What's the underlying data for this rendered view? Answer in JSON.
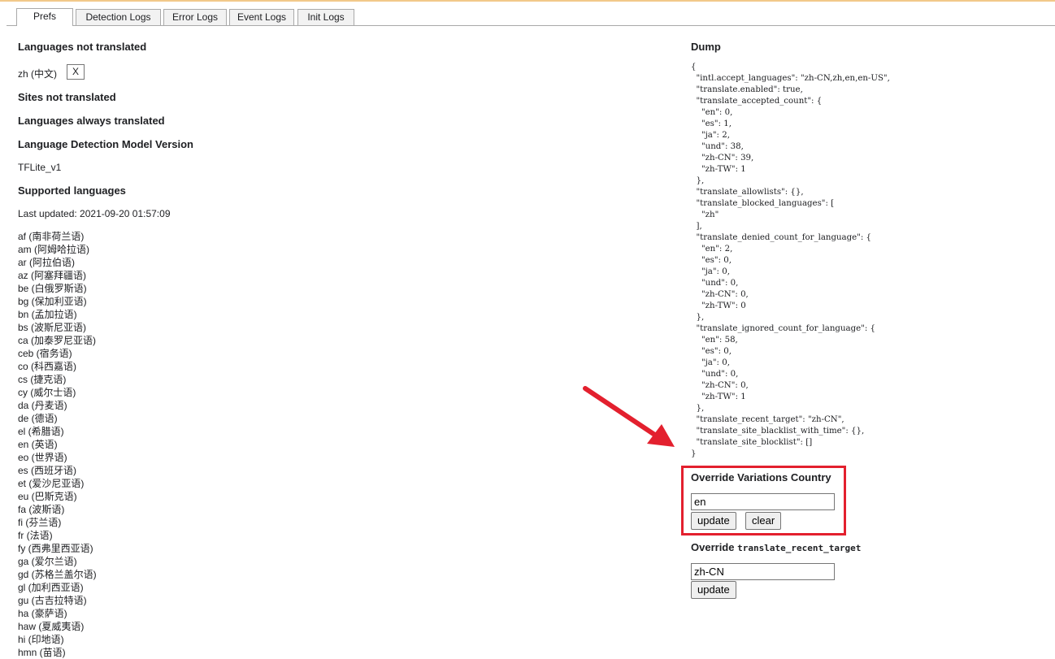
{
  "tabs": [
    {
      "label": "Prefs",
      "active": true
    },
    {
      "label": "Detection Logs",
      "active": false
    },
    {
      "label": "Error Logs",
      "active": false
    },
    {
      "label": "Event Logs",
      "active": false
    },
    {
      "label": "Init Logs",
      "active": false
    }
  ],
  "left": {
    "not_translated_heading": "Languages not translated",
    "not_translated_item": "zh (中文)",
    "remove_button": "X",
    "sites_heading": "Sites not translated",
    "always_heading": "Languages always translated",
    "model_heading": "Language Detection Model Version",
    "model_version": "TFLite_v1",
    "supported_heading": "Supported languages",
    "last_updated": "Last updated: 2021-09-20 01:57:09",
    "languages": [
      "af (南非荷兰语)",
      "am (阿姆哈拉语)",
      "ar (阿拉伯语)",
      "az (阿塞拜疆语)",
      "be (白俄罗斯语)",
      "bg (保加利亚语)",
      "bn (孟加拉语)",
      "bs (波斯尼亚语)",
      "ca (加泰罗尼亚语)",
      "ceb (宿务语)",
      "co (科西嘉语)",
      "cs (捷克语)",
      "cy (威尔士语)",
      "da (丹麦语)",
      "de (德语)",
      "el (希腊语)",
      "en (英语)",
      "eo (世界语)",
      "es (西班牙语)",
      "et (爱沙尼亚语)",
      "eu (巴斯克语)",
      "fa (波斯语)",
      "fi (芬兰语)",
      "fr (法语)",
      "fy (西弗里西亚语)",
      "ga (爱尔兰语)",
      "gd (苏格兰盖尔语)",
      "gl (加利西亚语)",
      "gu (古吉拉特语)",
      "ha (豪萨语)",
      "haw (夏威夷语)",
      "hi (印地语)",
      "hmn (苗语)"
    ]
  },
  "right": {
    "dump_heading": "Dump",
    "dump_text": "{\n  \"intl.accept_languages\": \"zh-CN,zh,en,en-US\",\n  \"translate.enabled\": true,\n  \"translate_accepted_count\": {\n    \"en\": 0,\n    \"es\": 1,\n    \"ja\": 2,\n    \"und\": 38,\n    \"zh-CN\": 39,\n    \"zh-TW\": 1\n  },\n  \"translate_allowlists\": {},\n  \"translate_blocked_languages\": [\n    \"zh\"\n  ],\n  \"translate_denied_count_for_language\": {\n    \"en\": 2,\n    \"es\": 0,\n    \"ja\": 0,\n    \"und\": 0,\n    \"zh-CN\": 0,\n    \"zh-TW\": 0\n  },\n  \"translate_ignored_count_for_language\": {\n    \"en\": 58,\n    \"es\": 0,\n    \"ja\": 0,\n    \"und\": 0,\n    \"zh-CN\": 0,\n    \"zh-TW\": 1\n  },\n  \"translate_recent_target\": \"zh-CN\",\n  \"translate_site_blacklist_with_time\": {},\n  \"translate_site_blocklist\": []\n}",
    "override_country_heading": "Override Variations Country",
    "country_value": "en",
    "update_label": "update",
    "clear_label": "clear",
    "override_target_prefix": "Override",
    "override_target_code": "translate_recent_target",
    "target_value": "zh-CN",
    "update2_label": "update"
  },
  "annotation": {
    "highlight_color": "#e3202e",
    "arrow_color": "#e3202e"
  }
}
